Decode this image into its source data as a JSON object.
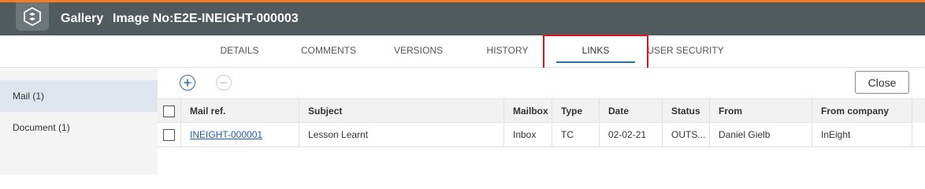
{
  "header": {
    "logo_icon": "ineight-logo-icon",
    "app_name": "Gallery",
    "image_no": "Image No:E2E-INEIGHT-000003",
    "accent_color": "#f47b20",
    "bar_color": "#4f5b5d"
  },
  "tabs": [
    {
      "label": "DETAILS",
      "active": false
    },
    {
      "label": "COMMENTS",
      "active": false
    },
    {
      "label": "VERSIONS",
      "active": false
    },
    {
      "label": "HISTORY",
      "active": false
    },
    {
      "label": "LINKS",
      "active": true
    },
    {
      "label": "USER SECURITY",
      "active": false
    }
  ],
  "sidebar": {
    "items": [
      {
        "label": "Mail (1)",
        "active": true
      },
      {
        "label": "Document (1)",
        "active": false
      }
    ]
  },
  "toolbar": {
    "add_icon": "plus-circle-icon",
    "remove_icon": "minus-circle-icon",
    "close_label": "Close"
  },
  "grid": {
    "headers": {
      "mail_ref": "Mail ref.",
      "subject": "Subject",
      "mailbox": "Mailbox",
      "type": "Type",
      "date": "Date",
      "status": "Status",
      "from": "From",
      "from_company": "From company"
    },
    "rows": [
      {
        "mail_ref": "INEIGHT-000001",
        "subject": "Lesson Learnt",
        "mailbox": "Inbox",
        "type": "TC",
        "date": "02-02-21",
        "status": "OUTS...",
        "from": "Daniel Gielb",
        "from_company": "InEight"
      }
    ]
  }
}
